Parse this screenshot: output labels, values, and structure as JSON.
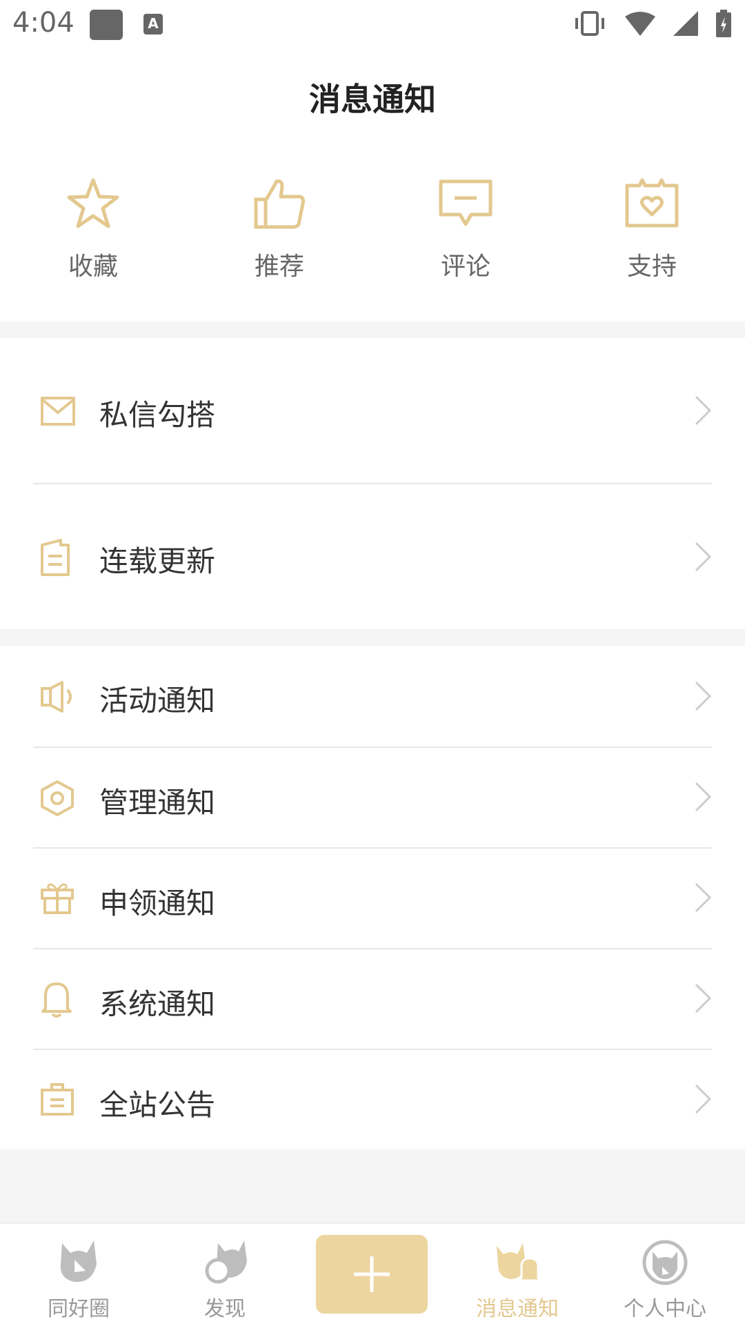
{
  "status": {
    "time": "4:04"
  },
  "header": {
    "title": "消息通知"
  },
  "actions": [
    {
      "label": "收藏",
      "icon": "star-icon"
    },
    {
      "label": "推荐",
      "icon": "thumbs-up-icon"
    },
    {
      "label": "评论",
      "icon": "comment-icon"
    },
    {
      "label": "支持",
      "icon": "gift-heart-icon"
    }
  ],
  "rows": [
    {
      "label": "私信勾搭",
      "icon": "mail-icon"
    },
    {
      "label": "连载更新",
      "icon": "document-icon"
    },
    {
      "label": "活动通知",
      "icon": "speaker-icon"
    },
    {
      "label": "管理通知",
      "icon": "settings-hex-icon"
    },
    {
      "label": "申领通知",
      "icon": "gift-icon"
    },
    {
      "label": "系统通知",
      "icon": "bell-icon"
    },
    {
      "label": "全站公告",
      "icon": "briefcase-icon"
    }
  ],
  "nav": [
    {
      "label": "同好圈"
    },
    {
      "label": "发现"
    },
    {
      "label": "消息通知"
    },
    {
      "label": "个人中心"
    }
  ],
  "colors": {
    "accent": "#e3c88f",
    "plus_bg": "#ecd59e",
    "gray_bg": "#f5f5f5"
  }
}
